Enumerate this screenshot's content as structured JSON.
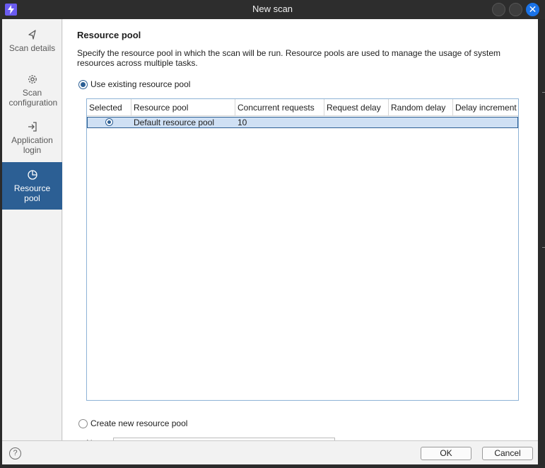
{
  "window": {
    "title": "New scan"
  },
  "sidebar": {
    "items": [
      {
        "label": "Scan details",
        "icon": "send-icon",
        "active": false
      },
      {
        "label": "Scan configuration",
        "icon": "gear-icon",
        "active": false
      },
      {
        "label": "Application login",
        "icon": "login-icon",
        "active": false
      },
      {
        "label": "Resource pool",
        "icon": "pie-chart-icon",
        "active": true
      }
    ]
  },
  "main": {
    "heading": "Resource pool",
    "description": "Specify the resource pool in which the scan will be run. Resource pools are used to manage the usage of system resources across multiple tasks.",
    "use_existing_label": "Use existing resource pool",
    "create_new_label": "Create new resource pool",
    "name_label": "Name",
    "table": {
      "columns": [
        "Selected",
        "Resource pool",
        "Concurrent requests",
        "Request delay",
        "Random delay",
        "Delay increment"
      ],
      "rows": [
        {
          "selected": true,
          "resource_pool": "Default resource pool",
          "concurrent_requests": "10",
          "request_delay": "",
          "random_delay": "",
          "delay_increment": ""
        }
      ]
    }
  },
  "footer": {
    "help": "?",
    "ok_label": "OK",
    "cancel_label": "Cancel"
  },
  "colors": {
    "accent": "#2c5f94",
    "selection": "#cfe0f4",
    "close_button": "#1a73e8",
    "app_icon": "#6b5cf0"
  }
}
